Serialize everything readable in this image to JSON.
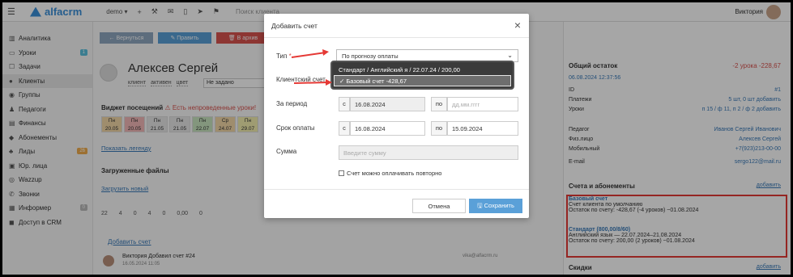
{
  "topbar": {
    "logo": "alfacrm",
    "demo": "demo ▾",
    "search_placeholder": "Поиск клиента",
    "user_name": "Виктория"
  },
  "sidebar": {
    "items": [
      {
        "label": "Аналитика",
        "icon": "chart-icon"
      },
      {
        "label": "Уроки",
        "icon": "calendar-icon",
        "badge": "1"
      },
      {
        "label": "Задачи",
        "icon": "tasks-icon"
      },
      {
        "label": "Клиенты",
        "icon": "user-icon",
        "active": true
      },
      {
        "label": "Группы",
        "icon": "group-icon"
      },
      {
        "label": "Педагоги",
        "icon": "teacher-icon"
      },
      {
        "label": "Финансы",
        "icon": "money-icon"
      },
      {
        "label": "Абонементы",
        "icon": "ticket-icon"
      },
      {
        "label": "Лиды",
        "icon": "leads-icon",
        "badge": "26"
      },
      {
        "label": "Юр. лица",
        "icon": "building-icon"
      },
      {
        "label": "Wazzup",
        "icon": "chat-icon"
      },
      {
        "label": "Звонки",
        "icon": "phone-icon"
      },
      {
        "label": "Информер",
        "icon": "informer-icon",
        "badge": "0"
      },
      {
        "label": "Доступ в CRM",
        "icon": "lock-icon"
      }
    ]
  },
  "actions": {
    "back": "← Вернуться",
    "edit": "✎ Править",
    "archive": "🗑 В архив"
  },
  "client": {
    "name": "Алексев Сергей",
    "tags": [
      "клиент",
      "активен",
      "цвет"
    ],
    "status_select": "Не задано",
    "widget_title": "Виджет посещений",
    "widget_warning": "Есть непроведенные уроки!",
    "days": [
      {
        "label": "Пн",
        "date": "20.05",
        "color": "#f5d9a8"
      },
      {
        "label": "Пн",
        "date": "20.05",
        "color": "#f5b8b8"
      },
      {
        "label": "Пн",
        "date": "21.05",
        "color": "#e8e8e8"
      },
      {
        "label": "Пн",
        "date": "21.05",
        "color": "#e8e8e8"
      },
      {
        "label": "Пн",
        "date": "22.07",
        "color": "#c9e6c0"
      },
      {
        "label": "Ср",
        "date": "24.07",
        "color": "#f5d9a8"
      },
      {
        "label": "Пн",
        "date": "29.07",
        "color": "#f5f0b0"
      }
    ],
    "legend_link": "Показать легенду",
    "files_title": "Загруженные файлы",
    "upload_link": "Загрузить новый",
    "stats": [
      "22",
      "4",
      "0",
      "4",
      "0",
      "0,00",
      "0"
    ],
    "add_bill": "Добавить счет",
    "feed_text": "Виктория Добавил счет #24",
    "feed_date": "16.05.2024  11:05",
    "feed_email": "vika@alfacrm.ru"
  },
  "right_panel": {
    "title": "Общий остаток",
    "balance": "-2 урока  -228,67",
    "date": "06.08.2024 12:37:56",
    "rows": [
      {
        "k": "ID",
        "v": "#1"
      },
      {
        "k": "Платежи",
        "v": "5 шт, 0 шт  добавить"
      },
      {
        "k": "Уроки",
        "v": "п 15 / ф 11, п 2 / ф 2  добавить"
      },
      {
        "k": "Педагог",
        "v": "Иванов Сергей Иванович"
      },
      {
        "k": "Физ.лицо",
        "v": "Алексев Сергей"
      },
      {
        "k": "Мобильный",
        "v": "+7(923)213-00-00"
      },
      {
        "k": "E-mail",
        "v": "sergo122@mail.ru"
      }
    ],
    "accounts_title": "Счета и абонементы",
    "accounts_link": "добавить",
    "account1_title": "Базовый счет",
    "account1_sub": "Счет клиента по умолчанию",
    "account1_bal": "Остаток по счету: -428,67 (-4 уроков) ~01.08.2024",
    "account2_title": "Стандарт (800,00/8/60)",
    "account2_sub": "Английский язык — 22.07.2024–21.08.2024",
    "account2_bal": "Остаток по счету: 200,00 (2 уроков) ~01.08.2024",
    "discounts_title": "Скидки",
    "discounts_link": "добавить"
  },
  "modal": {
    "title": "Добавить счет",
    "type_label": "Тип",
    "type_value": "По прогнозу оплаты",
    "client_account_label": "Клиентский счет",
    "period_label": "За период",
    "period_prefix": "с",
    "period_from": "16.08.2024",
    "period_to_label": "по",
    "period_to_placeholder": "дд.мм.гггг",
    "payment_label": "Срок оплаты",
    "payment_prefix": "с",
    "payment_from": "16.08.2024",
    "payment_to_label": "по",
    "payment_to": "15.09.2024",
    "sum_label": "Сумма",
    "sum_placeholder": "Введите сумму",
    "repeat_label": "Счет можно оплачивать повторно",
    "cancel": "Отмена",
    "save": "🖫 Сохранить",
    "dropdown_options": [
      "Стандарт / Английский я / 22.07.24 / 200,00",
      "✓ Базовый счет -428,67"
    ]
  }
}
